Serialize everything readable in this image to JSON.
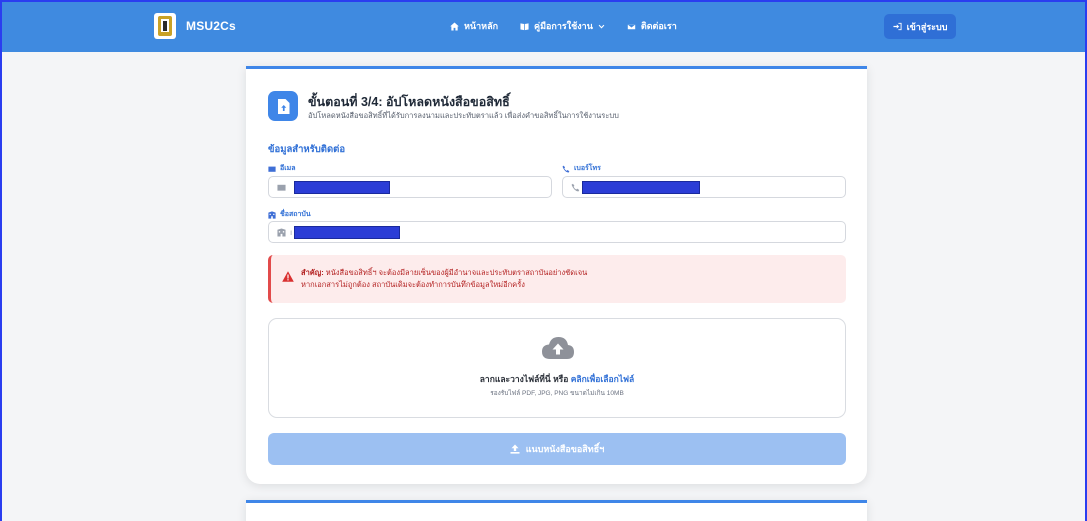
{
  "brand": {
    "name": "MSU2Cs"
  },
  "nav": {
    "home": "หน้าหลัก",
    "manual": "คู่มือการใช้งาน",
    "contact": "ติดต่อเรา",
    "login": "เข้าสู่ระบบ"
  },
  "step": {
    "title": "ขั้นตอนที่ 3/4: อัปโหลดหนังสือขอสิทธิ์",
    "description": "อัปโหลดหนังสือขอสิทธิ์ที่ได้รับการลงนามและประทับตราแล้ว เพื่อส่งคำขอสิทธิ์ในการใช้งานระบบ"
  },
  "contact": {
    "section_title": "ข้อมูลสำหรับติดต่อ",
    "email_label": "อีเมล",
    "phone_label": "เบอร์โทร",
    "org_label": "ชื่อสถาบัน",
    "org_prefix": "ı"
  },
  "alert": {
    "strong": "สำคัญ:",
    "line1": "หนังสือขอสิทธิ์ฯ จะต้องมีลายเซ็นของผู้มีอำนาจและประทับตราสถาบันอย่างชัดเจน",
    "line2": "หากเอกสารไม่ถูกต้อง สถาบันเดิมจะต้องทำการบันทึกข้อมูลใหม่อีกครั้ง"
  },
  "upload": {
    "main_text": "ลากและวางไฟล์ที่นี่ หรือ",
    "link_text": "คลิกเพื่อเลือกไฟล์",
    "sub_text": "รองรับไฟล์ PDF, JPG, PNG ขนาดไม่เกิน 10MB"
  },
  "submit": {
    "label": "แนบหนังสือขอสิทธิ์ฯ"
  },
  "colors": {
    "navbar": "#3f8ae0",
    "accent": "#2f6fd6",
    "alert_text": "#b42323",
    "alert_bg": "#fdecec",
    "submit_disabled": "#9cc0f2",
    "redaction": "#2b3dd6"
  },
  "icons": {
    "home": "home-icon",
    "manual": "book-icon",
    "contact": "envelope-icon",
    "login": "sign-in-icon",
    "step": "file-upload-icon",
    "email": "envelope-icon",
    "phone": "phone-icon",
    "org": "building-icon",
    "alert": "warning-triangle-icon",
    "cloud": "cloud-upload-icon",
    "submit": "upload-icon"
  }
}
